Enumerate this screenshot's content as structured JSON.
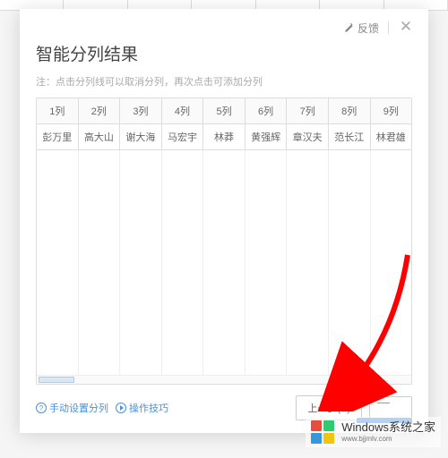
{
  "header": {
    "feedback_label": "反馈"
  },
  "dialog": {
    "title": "智能分列结果",
    "note": "注：点击分列线可以取消分列，再次点击可添加分列"
  },
  "table": {
    "headers": [
      "1列",
      "2列",
      "3列",
      "4列",
      "5列",
      "6列",
      "7列",
      "8列",
      "9列"
    ],
    "row1": [
      "彭万里",
      "高大山",
      "谢大海",
      "马宏宇",
      "林莽",
      "黄强辉",
      "章汉夫",
      "范长江",
      "林君雄"
    ]
  },
  "footer": {
    "manual_link": "手动设置分列",
    "tips_link": "操作技巧",
    "prev_button": "上一步(B)"
  },
  "watermark": {
    "cn": "Windows系统之家",
    "en": "www.bjjmlv.com"
  }
}
